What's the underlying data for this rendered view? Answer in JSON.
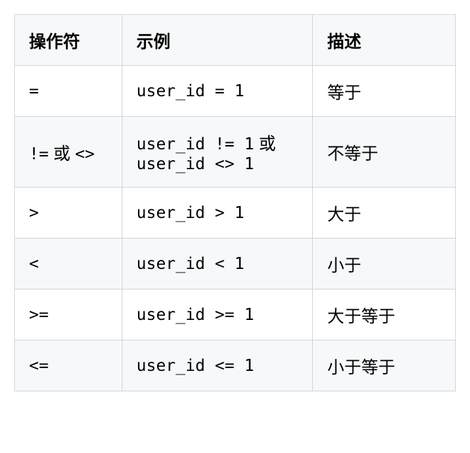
{
  "chart_data": {
    "type": "table",
    "headers": [
      "操作符",
      "示例",
      "描述"
    ],
    "rows": [
      {
        "operator": "=",
        "example": "user_id = 1",
        "description": "等于"
      },
      {
        "operator": "!= 或 <>",
        "example": "user_id != 1 或 user_id <> 1",
        "description": "不等于"
      },
      {
        "operator": ">",
        "example": "user_id > 1",
        "description": "大于"
      },
      {
        "operator": "<",
        "example": "user_id < 1",
        "description": "小于"
      },
      {
        "operator": ">=",
        "example": "user_id >= 1",
        "description": "大于等于"
      },
      {
        "operator": "<=",
        "example": "user_id <= 1",
        "description": "小于等于"
      }
    ]
  },
  "headers": {
    "col0": "操作符",
    "col1": "示例",
    "col2": "描述"
  },
  "rows": {
    "r0": {
      "operator_code": "=",
      "example_code": "user_id = 1",
      "description": "等于"
    },
    "r1": {
      "operator_code": "!=",
      "operator_text": " 或 ",
      "operator_code2": "<>",
      "example_code": "user_id != 1",
      "example_text": " 或 ",
      "example_code2": "user_id <> 1",
      "description": "不等于"
    },
    "r2": {
      "operator_code": ">",
      "example_code": "user_id > 1",
      "description": "大于"
    },
    "r3": {
      "operator_code": "<",
      "example_code": "user_id < 1",
      "description": "小于"
    },
    "r4": {
      "operator_code": ">=",
      "example_code": "user_id >= 1",
      "description": "大于等于"
    },
    "r5": {
      "operator_code": "<=",
      "example_code": "user_id <= 1",
      "description": "小于等于"
    }
  }
}
